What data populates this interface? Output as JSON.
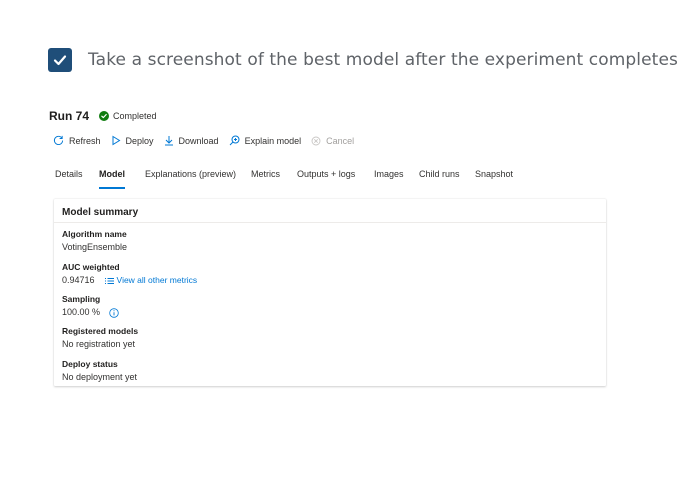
{
  "task": {
    "text": "Take a screenshot of the best model after the experiment completes",
    "checked": true
  },
  "run": {
    "title": "Run 74",
    "status": "Completed"
  },
  "toolbar": {
    "refresh": "Refresh",
    "deploy": "Deploy",
    "download": "Download",
    "explain": "Explain model",
    "cancel": "Cancel"
  },
  "tabs": [
    {
      "label": "Details",
      "active": false
    },
    {
      "label": "Model",
      "active": true
    },
    {
      "label": "Explanations (preview)",
      "active": false
    },
    {
      "label": "Metrics",
      "active": false
    },
    {
      "label": "Outputs + logs",
      "active": false
    },
    {
      "label": "Images",
      "active": false
    },
    {
      "label": "Child runs",
      "active": false
    },
    {
      "label": "Snapshot",
      "active": false
    }
  ],
  "summary": {
    "title": "Model summary",
    "algorithm_label": "Algorithm name",
    "algorithm_value": "VotingEnsemble",
    "auc_label": "AUC weighted",
    "auc_value": "0.94716",
    "metrics_link": "View all other metrics",
    "sampling_label": "Sampling",
    "sampling_value": "100.00 %",
    "registered_label": "Registered models",
    "registered_value": "No registration yet",
    "deploy_label": "Deploy status",
    "deploy_value": "No deployment yet"
  },
  "colors": {
    "checkbox": "#1f4e79",
    "accent": "#0078d4",
    "success": "#107c10"
  }
}
